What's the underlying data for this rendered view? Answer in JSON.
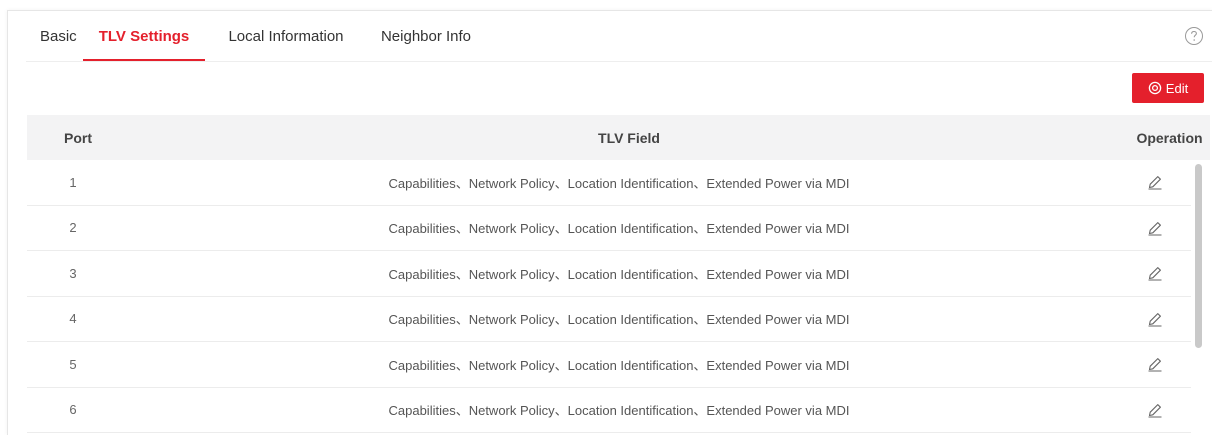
{
  "tabs": [
    {
      "label": "Basic",
      "active": false
    },
    {
      "label": "TLV Settings",
      "active": true
    },
    {
      "label": "Local Information",
      "active": false
    },
    {
      "label": "Neighbor Info",
      "active": false
    }
  ],
  "help": {
    "icon": "question-circle-icon"
  },
  "toolbar": {
    "edit_label": "Edit",
    "edit_icon": "settings-circle-icon"
  },
  "table": {
    "headers": {
      "port": "Port",
      "field": "TLV Field",
      "operation": "Operation"
    },
    "rows": [
      {
        "port": "1",
        "field": "Capabilities、Network Policy、Location Identification、Extended Power via MDI"
      },
      {
        "port": "2",
        "field": "Capabilities、Network Policy、Location Identification、Extended Power via MDI"
      },
      {
        "port": "3",
        "field": "Capabilities、Network Policy、Location Identification、Extended Power via MDI"
      },
      {
        "port": "4",
        "field": "Capabilities、Network Policy、Location Identification、Extended Power via MDI"
      },
      {
        "port": "5",
        "field": "Capabilities、Network Policy、Location Identification、Extended Power via MDI"
      },
      {
        "port": "6",
        "field": "Capabilities、Network Policy、Location Identification、Extended Power via MDI"
      }
    ],
    "row_action_icon": "pencil-edit-icon"
  },
  "colors": {
    "accent": "#e4202c",
    "header_bg": "#f3f3f4"
  }
}
